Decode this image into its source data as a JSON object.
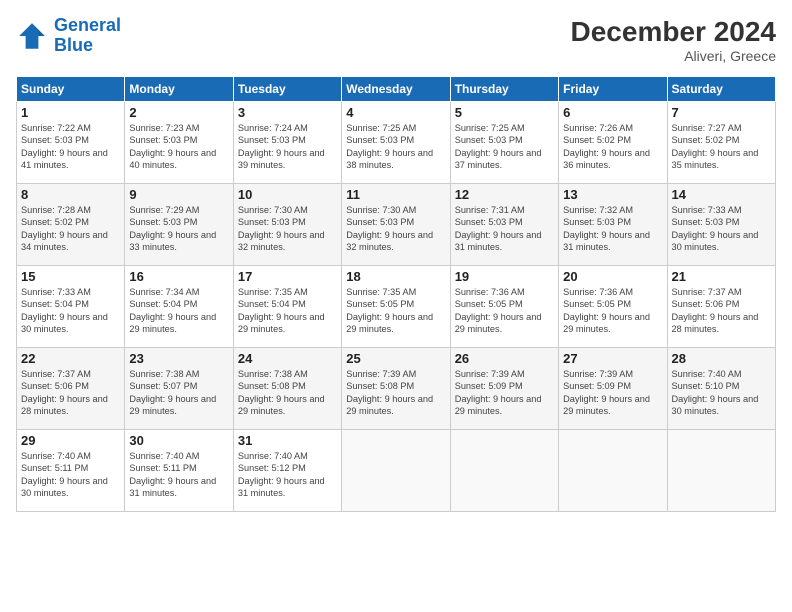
{
  "header": {
    "logo_line1": "General",
    "logo_line2": "Blue",
    "month": "December 2024",
    "location": "Aliveri, Greece"
  },
  "weekdays": [
    "Sunday",
    "Monday",
    "Tuesday",
    "Wednesday",
    "Thursday",
    "Friday",
    "Saturday"
  ],
  "weeks": [
    [
      {
        "day": "1",
        "sunrise": "Sunrise: 7:22 AM",
        "sunset": "Sunset: 5:03 PM",
        "daylight": "Daylight: 9 hours and 41 minutes."
      },
      {
        "day": "2",
        "sunrise": "Sunrise: 7:23 AM",
        "sunset": "Sunset: 5:03 PM",
        "daylight": "Daylight: 9 hours and 40 minutes."
      },
      {
        "day": "3",
        "sunrise": "Sunrise: 7:24 AM",
        "sunset": "Sunset: 5:03 PM",
        "daylight": "Daylight: 9 hours and 39 minutes."
      },
      {
        "day": "4",
        "sunrise": "Sunrise: 7:25 AM",
        "sunset": "Sunset: 5:03 PM",
        "daylight": "Daylight: 9 hours and 38 minutes."
      },
      {
        "day": "5",
        "sunrise": "Sunrise: 7:25 AM",
        "sunset": "Sunset: 5:03 PM",
        "daylight": "Daylight: 9 hours and 37 minutes."
      },
      {
        "day": "6",
        "sunrise": "Sunrise: 7:26 AM",
        "sunset": "Sunset: 5:02 PM",
        "daylight": "Daylight: 9 hours and 36 minutes."
      },
      {
        "day": "7",
        "sunrise": "Sunrise: 7:27 AM",
        "sunset": "Sunset: 5:02 PM",
        "daylight": "Daylight: 9 hours and 35 minutes."
      }
    ],
    [
      {
        "day": "8",
        "sunrise": "Sunrise: 7:28 AM",
        "sunset": "Sunset: 5:02 PM",
        "daylight": "Daylight: 9 hours and 34 minutes."
      },
      {
        "day": "9",
        "sunrise": "Sunrise: 7:29 AM",
        "sunset": "Sunset: 5:03 PM",
        "daylight": "Daylight: 9 hours and 33 minutes."
      },
      {
        "day": "10",
        "sunrise": "Sunrise: 7:30 AM",
        "sunset": "Sunset: 5:03 PM",
        "daylight": "Daylight: 9 hours and 32 minutes."
      },
      {
        "day": "11",
        "sunrise": "Sunrise: 7:30 AM",
        "sunset": "Sunset: 5:03 PM",
        "daylight": "Daylight: 9 hours and 32 minutes."
      },
      {
        "day": "12",
        "sunrise": "Sunrise: 7:31 AM",
        "sunset": "Sunset: 5:03 PM",
        "daylight": "Daylight: 9 hours and 31 minutes."
      },
      {
        "day": "13",
        "sunrise": "Sunrise: 7:32 AM",
        "sunset": "Sunset: 5:03 PM",
        "daylight": "Daylight: 9 hours and 31 minutes."
      },
      {
        "day": "14",
        "sunrise": "Sunrise: 7:33 AM",
        "sunset": "Sunset: 5:03 PM",
        "daylight": "Daylight: 9 hours and 30 minutes."
      }
    ],
    [
      {
        "day": "15",
        "sunrise": "Sunrise: 7:33 AM",
        "sunset": "Sunset: 5:04 PM",
        "daylight": "Daylight: 9 hours and 30 minutes."
      },
      {
        "day": "16",
        "sunrise": "Sunrise: 7:34 AM",
        "sunset": "Sunset: 5:04 PM",
        "daylight": "Daylight: 9 hours and 29 minutes."
      },
      {
        "day": "17",
        "sunrise": "Sunrise: 7:35 AM",
        "sunset": "Sunset: 5:04 PM",
        "daylight": "Daylight: 9 hours and 29 minutes."
      },
      {
        "day": "18",
        "sunrise": "Sunrise: 7:35 AM",
        "sunset": "Sunset: 5:05 PM",
        "daylight": "Daylight: 9 hours and 29 minutes."
      },
      {
        "day": "19",
        "sunrise": "Sunrise: 7:36 AM",
        "sunset": "Sunset: 5:05 PM",
        "daylight": "Daylight: 9 hours and 29 minutes."
      },
      {
        "day": "20",
        "sunrise": "Sunrise: 7:36 AM",
        "sunset": "Sunset: 5:05 PM",
        "daylight": "Daylight: 9 hours and 29 minutes."
      },
      {
        "day": "21",
        "sunrise": "Sunrise: 7:37 AM",
        "sunset": "Sunset: 5:06 PM",
        "daylight": "Daylight: 9 hours and 28 minutes."
      }
    ],
    [
      {
        "day": "22",
        "sunrise": "Sunrise: 7:37 AM",
        "sunset": "Sunset: 5:06 PM",
        "daylight": "Daylight: 9 hours and 28 minutes."
      },
      {
        "day": "23",
        "sunrise": "Sunrise: 7:38 AM",
        "sunset": "Sunset: 5:07 PM",
        "daylight": "Daylight: 9 hours and 29 minutes."
      },
      {
        "day": "24",
        "sunrise": "Sunrise: 7:38 AM",
        "sunset": "Sunset: 5:08 PM",
        "daylight": "Daylight: 9 hours and 29 minutes."
      },
      {
        "day": "25",
        "sunrise": "Sunrise: 7:39 AM",
        "sunset": "Sunset: 5:08 PM",
        "daylight": "Daylight: 9 hours and 29 minutes."
      },
      {
        "day": "26",
        "sunrise": "Sunrise: 7:39 AM",
        "sunset": "Sunset: 5:09 PM",
        "daylight": "Daylight: 9 hours and 29 minutes."
      },
      {
        "day": "27",
        "sunrise": "Sunrise: 7:39 AM",
        "sunset": "Sunset: 5:09 PM",
        "daylight": "Daylight: 9 hours and 29 minutes."
      },
      {
        "day": "28",
        "sunrise": "Sunrise: 7:40 AM",
        "sunset": "Sunset: 5:10 PM",
        "daylight": "Daylight: 9 hours and 30 minutes."
      }
    ],
    [
      {
        "day": "29",
        "sunrise": "Sunrise: 7:40 AM",
        "sunset": "Sunset: 5:11 PM",
        "daylight": "Daylight: 9 hours and 30 minutes."
      },
      {
        "day": "30",
        "sunrise": "Sunrise: 7:40 AM",
        "sunset": "Sunset: 5:11 PM",
        "daylight": "Daylight: 9 hours and 31 minutes."
      },
      {
        "day": "31",
        "sunrise": "Sunrise: 7:40 AM",
        "sunset": "Sunset: 5:12 PM",
        "daylight": "Daylight: 9 hours and 31 minutes."
      },
      null,
      null,
      null,
      null
    ]
  ]
}
